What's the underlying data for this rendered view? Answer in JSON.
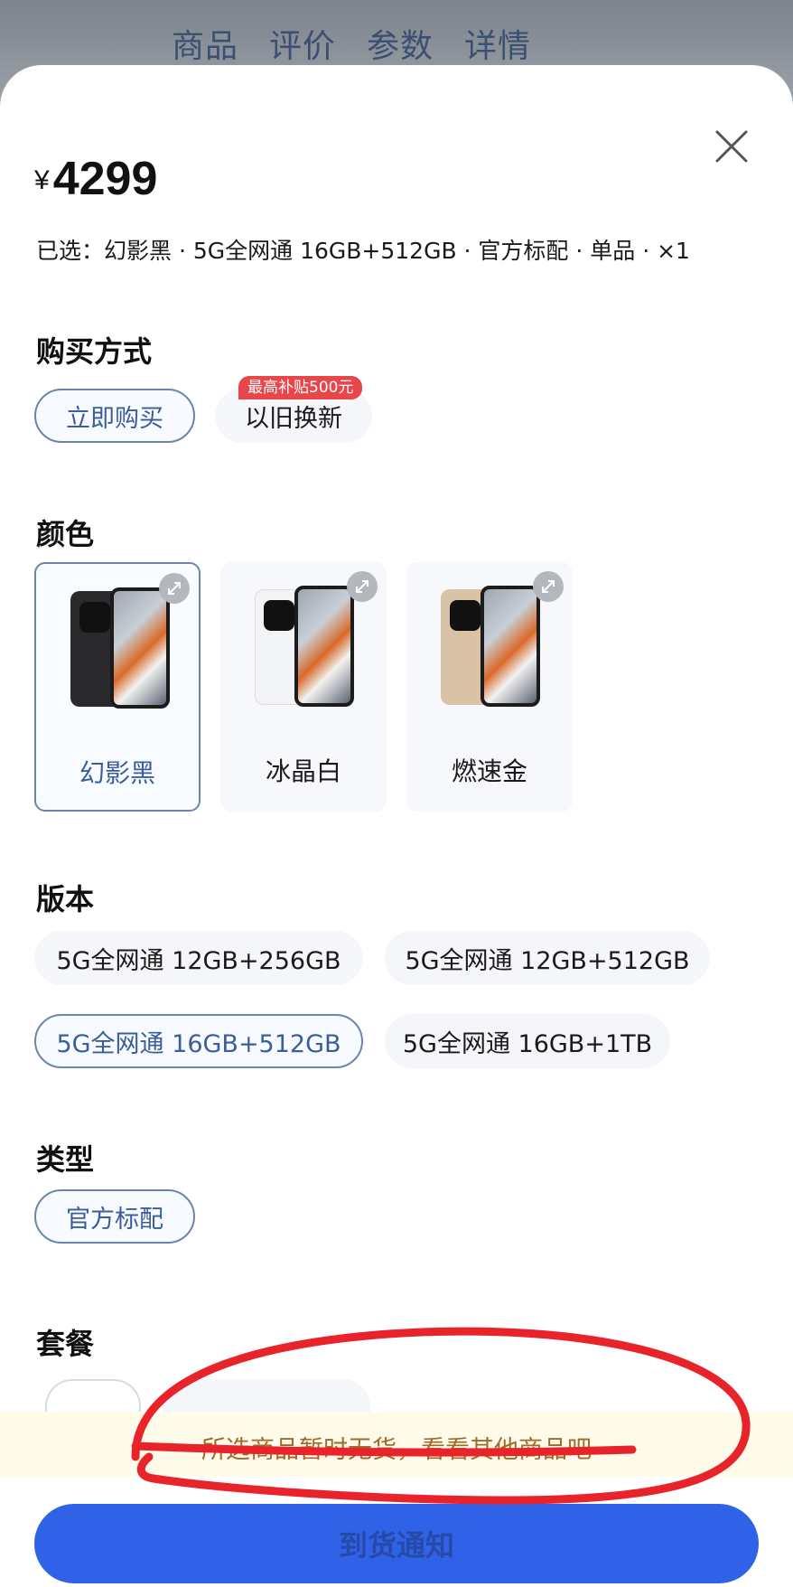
{
  "background": {
    "tabs": [
      "商品",
      "评价",
      "参数",
      "详情"
    ]
  },
  "sheet": {
    "price": {
      "currency": "¥",
      "amount": "4299"
    },
    "selected_summary": "已选：幻影黑 · 5G全网通 16GB+512GB · 官方标配 · 单品 · ×1",
    "purchase_method": {
      "title": "购买方式",
      "options": [
        {
          "label": "立即购买",
          "selected": true
        },
        {
          "label": "以旧换新",
          "selected": false,
          "badge": "最高补贴500元"
        }
      ]
    },
    "color": {
      "title": "颜色",
      "options": [
        {
          "label": "幻影黑",
          "selected": true,
          "swatch": "#2a2a2c"
        },
        {
          "label": "冰晶白",
          "selected": false,
          "swatch": "#f3f4f6"
        },
        {
          "label": "燃速金",
          "selected": false,
          "swatch": "#d9c2a6"
        }
      ]
    },
    "version": {
      "title": "版本",
      "options": [
        {
          "label": "5G全网通 12GB+256GB",
          "selected": false
        },
        {
          "label": "5G全网通 12GB+512GB",
          "selected": false
        },
        {
          "label": "5G全网通 16GB+512GB",
          "selected": true
        },
        {
          "label": "5G全网通 16GB+1TB",
          "selected": false
        }
      ]
    },
    "type": {
      "title": "类型",
      "options": [
        {
          "label": "官方标配",
          "selected": true
        }
      ]
    },
    "package": {
      "title": "套餐"
    },
    "out_of_stock_notice": "所选商品暂时无货，看看其他商品吧",
    "primary_button_label": "到货通知"
  },
  "colors": {
    "accent": "#3b5d99",
    "button": "#2f62e6",
    "badge": "#e8464a",
    "notice_text": "#a06a2a",
    "annotation": "#e8232a"
  }
}
